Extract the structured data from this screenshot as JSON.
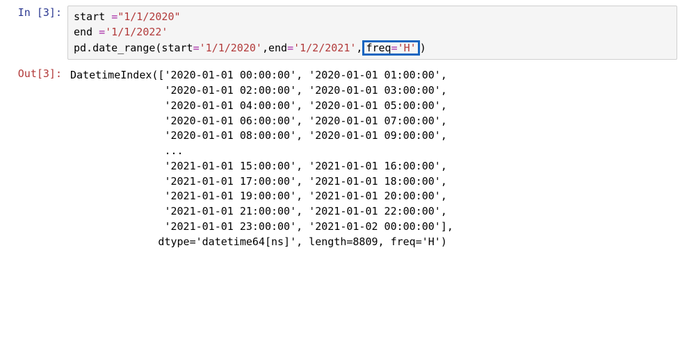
{
  "input": {
    "prompt": "In [3]:",
    "line1_id": "start ",
    "line1_eq": "=",
    "line1_str": "\"1/1/2020\"",
    "line2_id": "end ",
    "line2_eq": "=",
    "line2_str": "'1/1/2022'",
    "line3_pre": "pd.date_range(start",
    "line3_eq1": "=",
    "line3_str1": "'1/1/2020'",
    "line3_mid": ",end",
    "line3_eq2": "=",
    "line3_str2": "'1/2/2021'",
    "line3_comma": ",",
    "line3_hl_key": "freq",
    "line3_hl_eq": "=",
    "line3_hl_str": "'H'",
    "line3_end": ")"
  },
  "output": {
    "prompt": "Out[3]:",
    "l1": "DatetimeIndex(['2020-01-01 00:00:00', '2020-01-01 01:00:00',",
    "l2": "               '2020-01-01 02:00:00', '2020-01-01 03:00:00',",
    "l3": "               '2020-01-01 04:00:00', '2020-01-01 05:00:00',",
    "l4": "               '2020-01-01 06:00:00', '2020-01-01 07:00:00',",
    "l5": "               '2020-01-01 08:00:00', '2020-01-01 09:00:00',",
    "l6": "               ...",
    "l7": "               '2021-01-01 15:00:00', '2021-01-01 16:00:00',",
    "l8": "               '2021-01-01 17:00:00', '2021-01-01 18:00:00',",
    "l9": "               '2021-01-01 19:00:00', '2021-01-01 20:00:00',",
    "l10": "               '2021-01-01 21:00:00', '2021-01-01 22:00:00',",
    "l11": "               '2021-01-01 23:00:00', '2021-01-02 00:00:00'],",
    "l12": "              dtype='datetime64[ns]', length=8809, freq='H')"
  }
}
